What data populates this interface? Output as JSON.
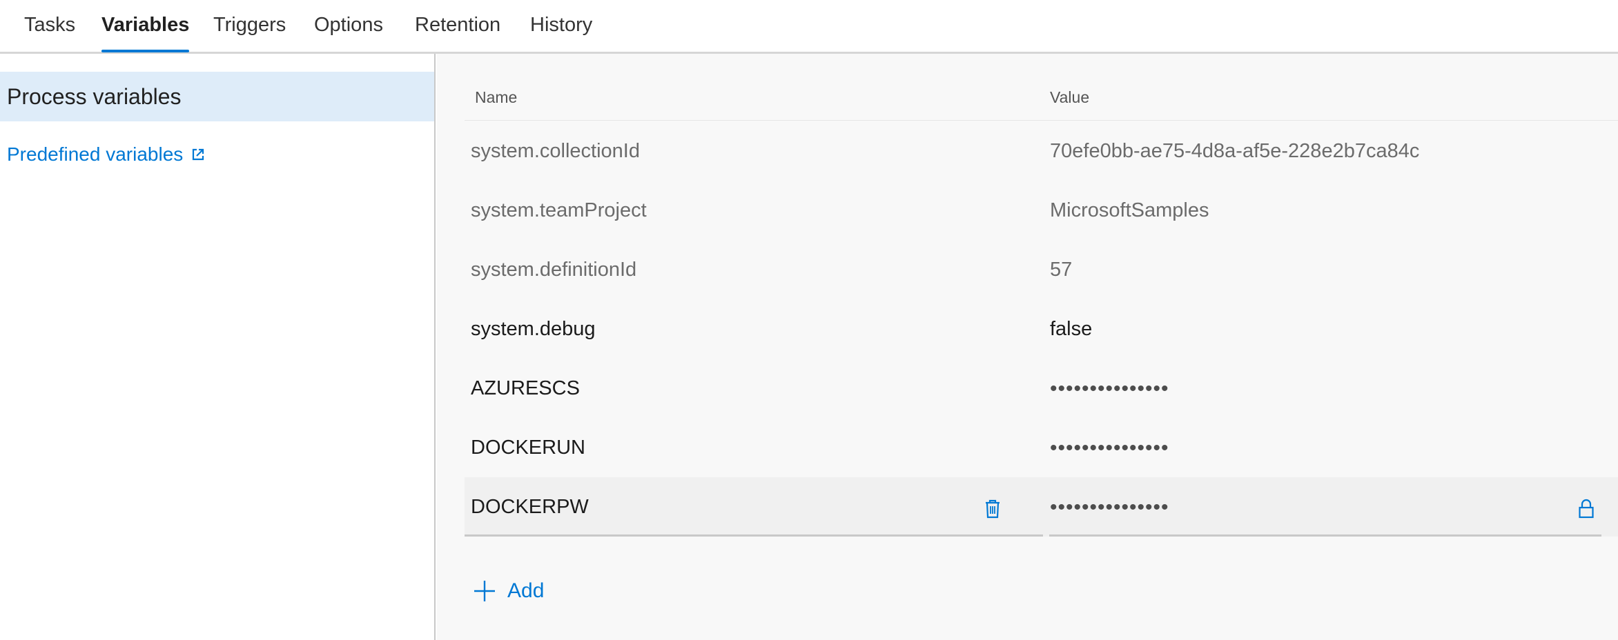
{
  "tabs": [
    {
      "label": "Tasks",
      "active": false
    },
    {
      "label": "Variables",
      "active": true
    },
    {
      "label": "Triggers",
      "active": false
    },
    {
      "label": "Options",
      "active": false
    },
    {
      "label": "Retention",
      "active": false
    },
    {
      "label": "History",
      "active": false
    }
  ],
  "sidebar": {
    "selected_item": "Process variables",
    "link_label": "Predefined variables",
    "link_icon": "external-link-icon"
  },
  "table": {
    "headers": {
      "name": "Name",
      "value": "Value"
    },
    "rows": [
      {
        "name": "system.collectionId",
        "value": "70efe0bb-ae75-4d8a-af5e-228e2b7ca84c",
        "readonly": true
      },
      {
        "name": "system.teamProject",
        "value": "MicrosoftSamples",
        "readonly": true
      },
      {
        "name": "system.definitionId",
        "value": "57",
        "readonly": true
      },
      {
        "name": "system.debug",
        "value": "false",
        "readonly": false
      },
      {
        "name": "AZURESCS",
        "value": "•••••••••••••••",
        "readonly": false,
        "secret": true
      },
      {
        "name": "DOCKERUN",
        "value": "•••••••••••••••",
        "readonly": false,
        "secret": true
      },
      {
        "name": "DOCKERPW",
        "value": "•••••••••••••••",
        "readonly": false,
        "secret": true,
        "editing": true
      }
    ]
  },
  "row_icons": {
    "delete": "trash-icon",
    "lock": "lock-icon"
  },
  "add_button": {
    "label": "Add",
    "icon": "plus-icon"
  },
  "colors": {
    "accent": "#0078d4",
    "selected_bg": "#deecf9",
    "panel_bg": "#f8f8f8"
  }
}
